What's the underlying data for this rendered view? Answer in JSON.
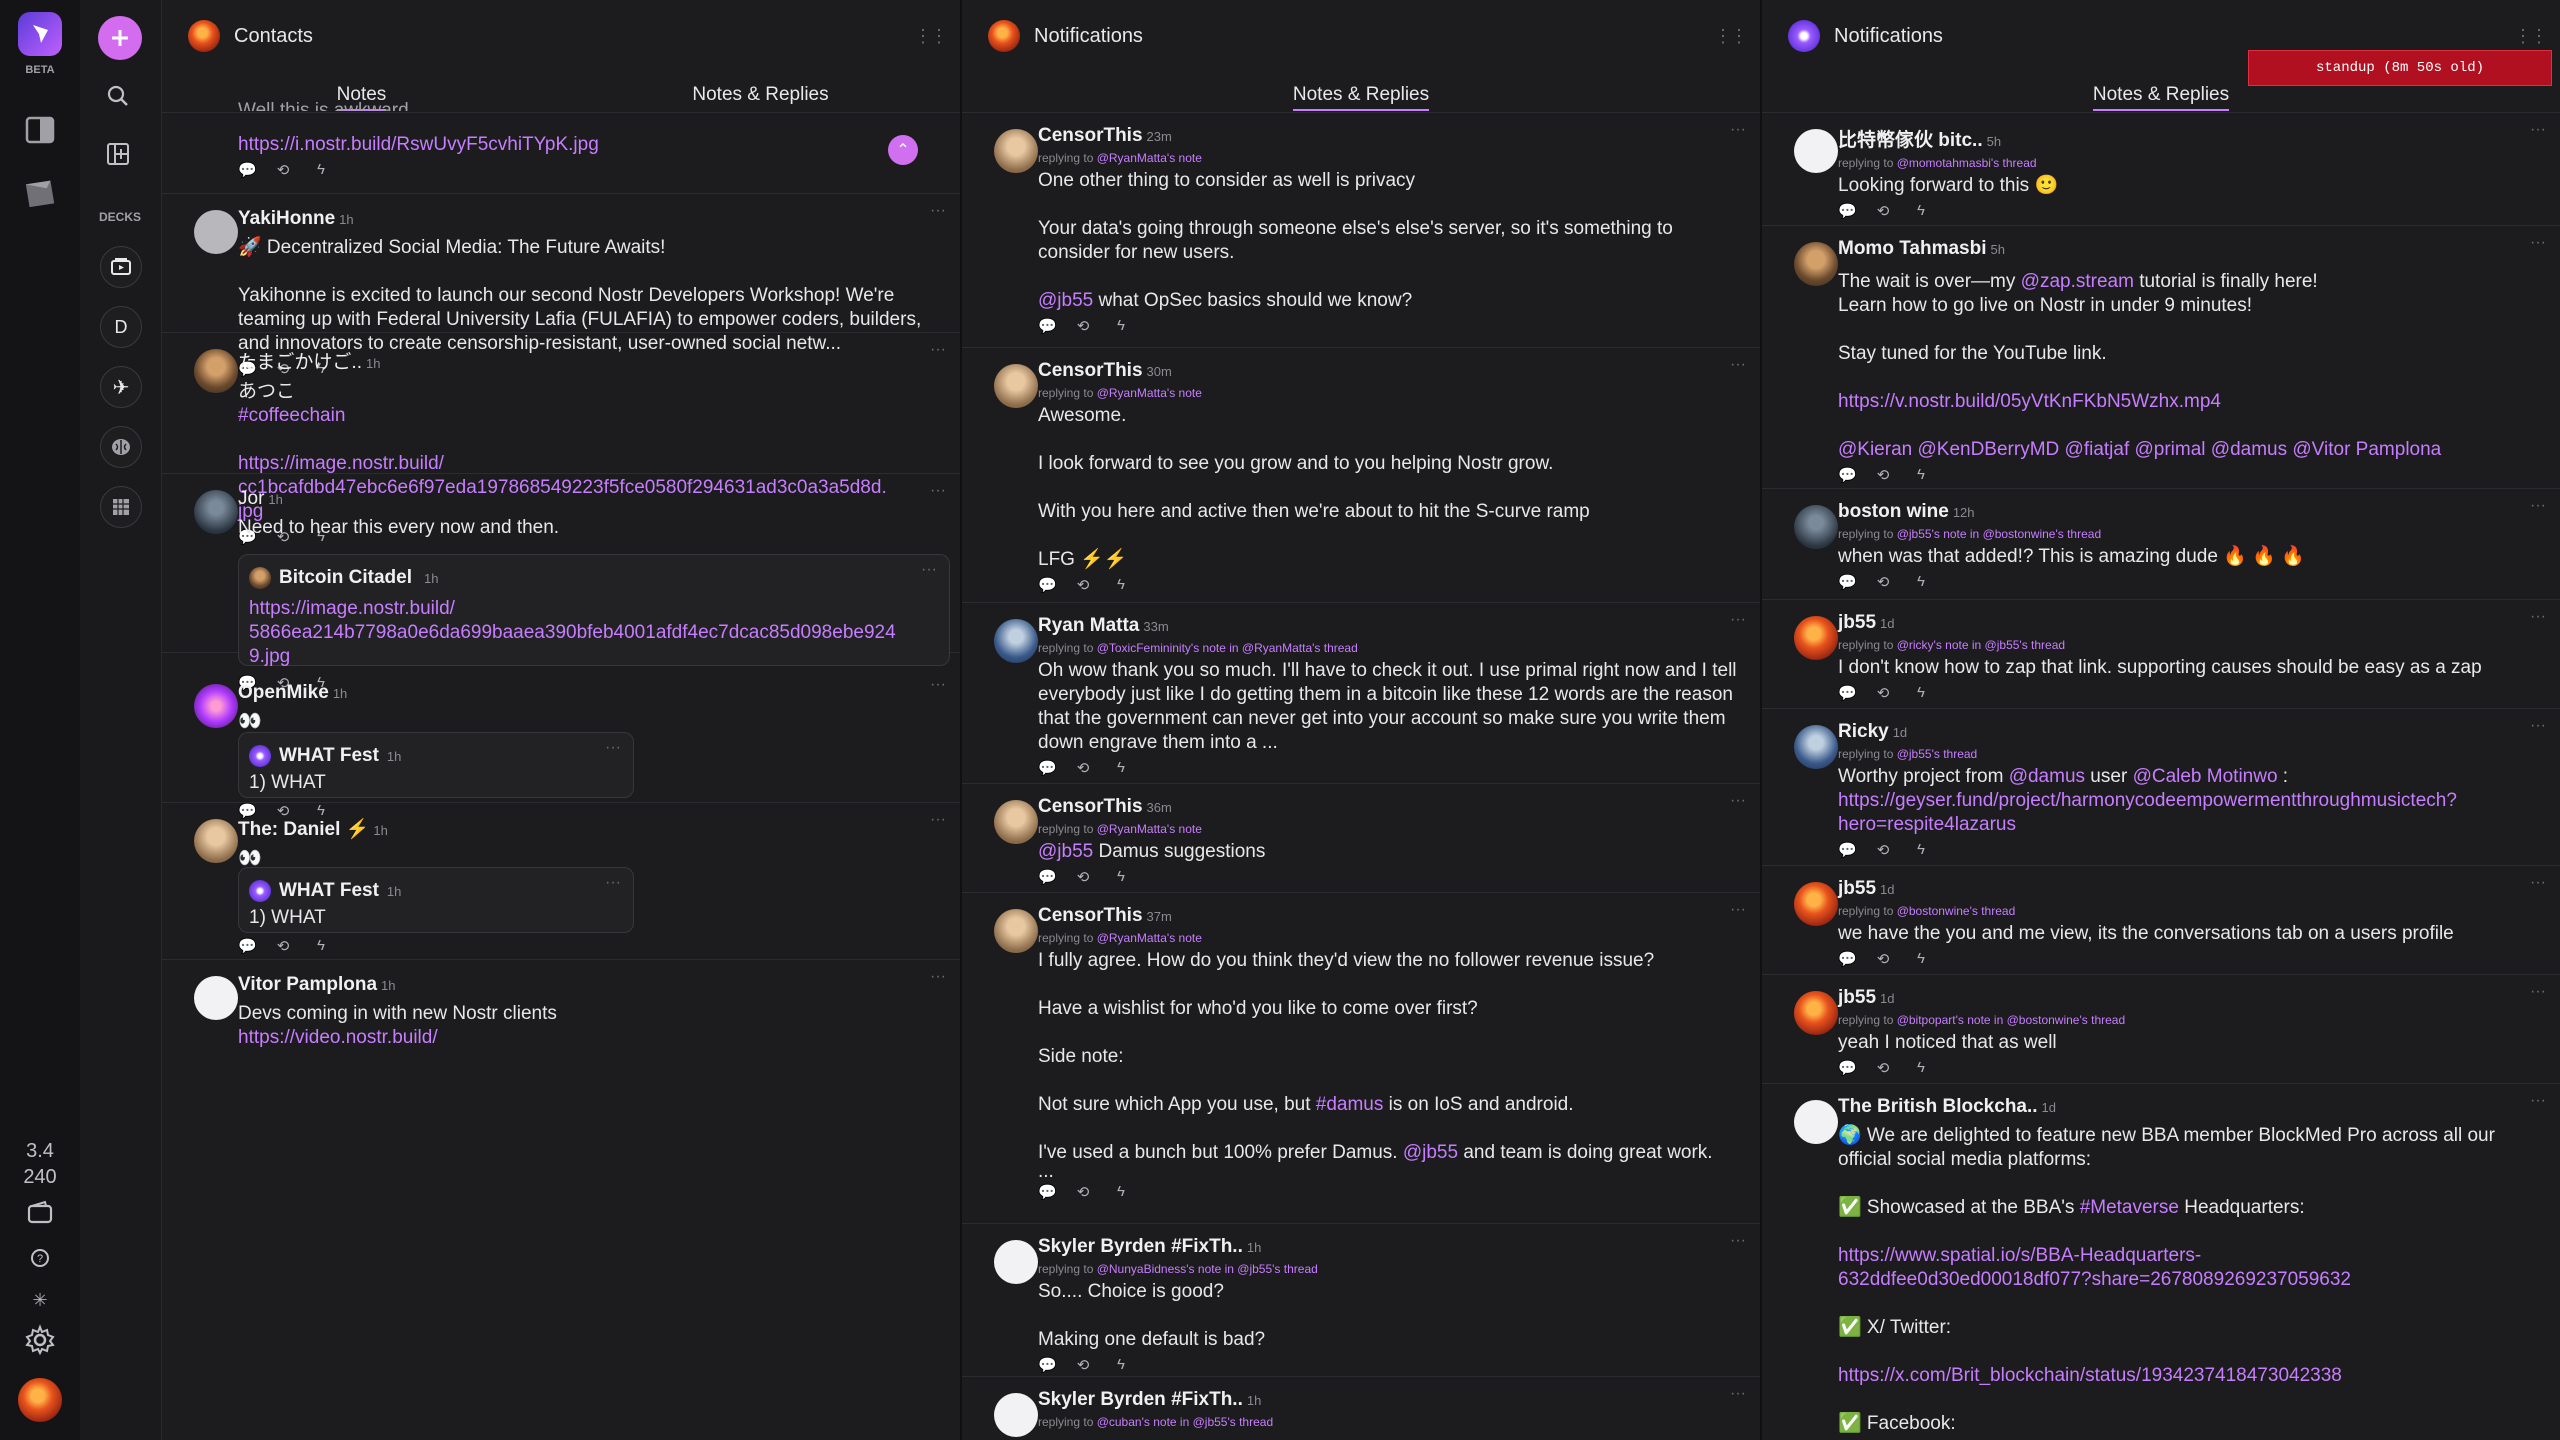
{
  "rail": {
    "beta_label": "BETA",
    "stats_top": "3.4",
    "stats_bottom": "240"
  },
  "sidebar": {
    "decks_label": "DECKS",
    "deck_d_label": "D"
  },
  "columns": [
    {
      "title": "Contacts",
      "tabs": [
        "Notes",
        "Notes & Replies"
      ],
      "active_tab": "Notes"
    },
    {
      "title": "Notifications",
      "tabs": [
        "Notes & Replies"
      ],
      "active_tab": "Notes & Replies"
    },
    {
      "title": "Notifications",
      "tabs": [
        "Notes & Replies"
      ],
      "active_tab": "Notes & Replies"
    }
  ],
  "standup": "standup (8m 50s old)",
  "col1": {
    "partial_text": "Well this is awkward",
    "partial_link": "https://i.nostr.build/RswUvyF5cvhiTYpK.jpg",
    "posts": [
      {
        "name": "YakiHonne",
        "time": "1h",
        "text": "🚀 Decentralized Social Media: The Future Awaits!\n\nYakihonne is excited to launch our second Nostr Developers Workshop! We're teaming up with  Federal University Lafia (FULAFIA) to empower coders, builders, and innovators to create censorship-resistant, user-owned social netw..."
      },
      {
        "name": "たまごかけご..",
        "time": "1h",
        "text": "あつこ",
        "hashtag": "#coffeechain",
        "link": "https://image.nostr.build/\ncc1bcafdbd47ebc6e6f97eda197868549223f5fce0580f294631ad3c0a3a5d8d.\njpg"
      },
      {
        "name": "Jor",
        "time": "1h",
        "text": "Need to hear this every now and then.",
        "quote_name": "Bitcoin Citadel",
        "quote_time": "1h",
        "quote_link": "https://image.nostr.build/\n5866ea214b7798a0e6da699baaea390bfeb4001afdf4ec7dcac85d098ebe924\n9.jpg"
      },
      {
        "name": "OpenMike",
        "time": "1h",
        "text": "👀",
        "quote_name": "WHAT Fest",
        "quote_time": "1h",
        "quote_text": "1) WHAT"
      },
      {
        "name": "The: Daniel ⚡",
        "time": "1h",
        "text": "👀",
        "quote_name": "WHAT Fest",
        "quote_time": "1h",
        "quote_text": "1) WHAT"
      },
      {
        "name": "Vitor Pamplona",
        "time": "1h",
        "text": "Devs coming in with new Nostr clients",
        "link": "https://video.nostr.build/"
      }
    ]
  },
  "col2": {
    "posts": [
      {
        "name": "CensorThis",
        "time": "23m",
        "reply_pre": "replying to ",
        "reply_user": "@RyanMatta",
        "reply_post": "'s note",
        "text": "One other thing to consider as well is privacy\n\nYour data's going through someone else's else's server, so it's something to consider for new users.",
        "mention": "@jb55",
        "after_mention": " what OpSec basics should we know?"
      },
      {
        "name": "CensorThis",
        "time": "30m",
        "reply_pre": "replying to ",
        "reply_user": "@RyanMatta",
        "reply_post": "'s note",
        "text": "Awesome.\n\nI look forward to see you grow and to you helping Nostr grow.\n\nWith you here and active then we're about to hit the S-curve ramp\n\nLFG ⚡⚡"
      },
      {
        "name": "Ryan Matta",
        "time": "33m",
        "reply_pre": "replying to ",
        "reply_user": "@ToxicFemininity",
        "reply_post": "'s note in ",
        "reply_user2": "@RyanMatta",
        "reply_post2": "'s thread",
        "text": "Oh wow thank you so much. I'll have to check it out. I use primal right now and I tell everybody just like I do getting them in a bitcoin like these 12 words are the reason that the government can never get into your account so make sure you write them down engrave them into a ..."
      },
      {
        "name": "CensorThis",
        "time": "36m",
        "reply_pre": "replying to ",
        "reply_user": "@RyanMatta",
        "reply_post": "'s note",
        "mention": "@jb55",
        "after_mention": " Damus suggestions"
      },
      {
        "name": "CensorThis",
        "time": "37m",
        "reply_pre": "replying to ",
        "reply_user": "@RyanMatta",
        "reply_post": "'s note",
        "text": "I fully agree. How do you think they'd view the no follower revenue issue?\n\nHave a wishlist for who'd you like to come over first?\n\nSide note:",
        "line_a": "Not sure which App you use, but ",
        "hashtag": "#damus",
        "line_b": " is on IoS and android.",
        "line_c": "I've used a bunch but 100% prefer Damus. ",
        "mention": "@jb55",
        "line_d": " and team is doing great work.",
        "ellipsis": "..."
      },
      {
        "name": "Skyler Byrden #FixTh..",
        "time": "1h",
        "reply_pre": "replying to ",
        "reply_user": "@NunyaBidness",
        "reply_post": "'s note in ",
        "reply_user2": "@jb55",
        "reply_post2": "'s thread",
        "text": "So.... Choice is good?\n\nMaking one default is bad?"
      },
      {
        "name": "Skyler Byrden #FixTh..",
        "time": "1h",
        "reply_pre": "replying to ",
        "reply_user": "@cuban",
        "reply_post": "'s note in ",
        "reply_user2": "@jb55",
        "reply_post2": "'s thread"
      }
    ]
  },
  "col3": {
    "posts": [
      {
        "name": "比特幣傢伙 bitc..",
        "time": "5h",
        "reply_pre": "replying to ",
        "reply_user": "@momotahmasbi",
        "reply_post": "'s thread",
        "text": "Looking forward to this 🙂"
      },
      {
        "name": "Momo Tahmasbi",
        "time": "5h",
        "text_a": "The wait is over—my ",
        "mention": "@zap.stream",
        "text_b": " tutorial is finally here!\nLearn how to go live on Nostr in under 9 minutes!\n\nStay tuned for the YouTube link.",
        "link": "https://v.nostr.build/05yVtKnFKbN5Wzhx.mp4",
        "mentions": "@Kieran @KenDBerryMD @fiatjaf @primal @damus @Vitor Pamplona"
      },
      {
        "name": "boston wine",
        "time": "12h",
        "reply_pre": "replying to ",
        "reply_user": "@jb55",
        "reply_post": "'s note in ",
        "reply_user2": "@bostonwine",
        "reply_post2": "'s thread",
        "text": " when was that added!? This is amazing dude 🔥 🔥 🔥"
      },
      {
        "name": "jb55",
        "time": "1d",
        "reply_pre": "replying to ",
        "reply_user": "@ricky",
        "reply_post": "'s note in ",
        "reply_user2": "@jb55",
        "reply_post2": "'s thread",
        "text": "I don't know how to zap that link. supporting causes should be easy as a zap"
      },
      {
        "name": "Ricky",
        "time": "1d",
        "reply_pre": "replying to ",
        "reply_user": "@jb55",
        "reply_post": "'s thread",
        "text_a": "Worthy project from ",
        "mention": "@damus",
        "text_b": " user ",
        "mention2": "@Caleb Motinwo",
        "text_c": " :",
        "link": "https://geyser.fund/project/harmonycodeempowermentthroughmusictech?\nhero=respite4lazarus"
      },
      {
        "name": "jb55",
        "time": "1d",
        "reply_pre": "replying to ",
        "reply_user": "@bostonwine",
        "reply_post": "'s thread",
        "text": "we have the you and me view, its the conversations tab on a users profile"
      },
      {
        "name": "jb55",
        "time": "1d",
        "reply_pre": "replying to ",
        "reply_user": "@bitpopart",
        "reply_post": "'s note in ",
        "reply_user2": "@bostonwine",
        "reply_post2": "'s thread",
        "text": "yeah I noticed that as well"
      },
      {
        "name": "The British Blockcha..",
        "time": "1d",
        "text": "🌍 We are delighted to feature new BBA member BlockMed Pro across all our official social media platforms:",
        "item1_a": "✅ Showcased at the BBA's ",
        "hashtag": "#Metaverse",
        "item1_b": " Headquarters:",
        "link1": "https://www.spatial.io/s/BBA-Headquarters-\n632ddfee0d30ed00018df077?share=2678089269237059632",
        "item2": "✅ X/ Twitter:",
        "link2": "https://x.com/Brit_blockchain/status/1934237418473042338",
        "item3": "✅ Facebook:"
      }
    ]
  },
  "colors": {
    "accent": "#c77dff",
    "background": "#1c1c1e",
    "standup_bg": "#b01020"
  }
}
